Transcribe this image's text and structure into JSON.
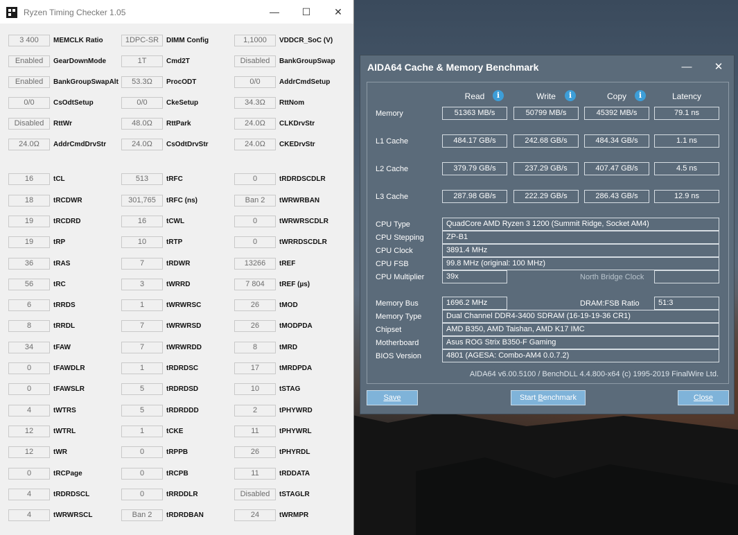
{
  "rtc": {
    "title": "Ryzen Timing Checker 1.05",
    "controls": {
      "minimize": "—",
      "maximize": "☐",
      "close": "✕"
    },
    "rows": [
      [
        {
          "v": "3 400",
          "l": "MEMCLK Ratio"
        },
        {
          "v": "1DPC-SR",
          "l": "DIMM Config"
        },
        {
          "v": "1,1000",
          "l": "VDDCR_SoC (V)"
        }
      ],
      [
        {
          "v": "Enabled",
          "l": "GearDownMode"
        },
        {
          "v": "1T",
          "l": "Cmd2T"
        },
        {
          "v": "Disabled",
          "l": "BankGroupSwap"
        }
      ],
      [
        {
          "v": "Enabled",
          "l": "BankGroupSwapAlt"
        },
        {
          "v": "53.3Ω",
          "l": "ProcODT"
        },
        {
          "v": "0/0",
          "l": "AddrCmdSetup"
        }
      ],
      [
        {
          "v": "0/0",
          "l": "CsOdtSetup"
        },
        {
          "v": "0/0",
          "l": "CkeSetup"
        },
        {
          "v": "34.3Ω",
          "l": "RttNom"
        }
      ],
      [
        {
          "v": "Disabled",
          "l": "RttWr"
        },
        {
          "v": "48.0Ω",
          "l": "RttPark"
        },
        {
          "v": "24.0Ω",
          "l": "CLKDrvStr"
        }
      ],
      [
        {
          "v": "24.0Ω",
          "l": "AddrCmdDrvStr"
        },
        {
          "v": "24.0Ω",
          "l": "CsOdtDrvStr"
        },
        {
          "v": "24.0Ω",
          "l": "CKEDrvStr"
        }
      ],
      [
        {
          "v": "16",
          "l": "tCL"
        },
        {
          "v": "513",
          "l": "tRFC"
        },
        {
          "v": "0",
          "l": "tRDRDSCDLR"
        }
      ],
      [
        {
          "v": "18",
          "l": "tRCDWR"
        },
        {
          "v": "301,765",
          "l": "tRFC (ns)"
        },
        {
          "v": "Ban 2",
          "l": "tWRWRBAN"
        }
      ],
      [
        {
          "v": "19",
          "l": "tRCDRD"
        },
        {
          "v": "16",
          "l": "tCWL"
        },
        {
          "v": "0",
          "l": "tWRWRSCDLR"
        }
      ],
      [
        {
          "v": "19",
          "l": "tRP"
        },
        {
          "v": "10",
          "l": "tRTP"
        },
        {
          "v": "0",
          "l": "tWRRDSCDLR"
        }
      ],
      [
        {
          "v": "36",
          "l": "tRAS"
        },
        {
          "v": "7",
          "l": "tRDWR"
        },
        {
          "v": "13266",
          "l": "tREF"
        }
      ],
      [
        {
          "v": "56",
          "l": "tRC"
        },
        {
          "v": "3",
          "l": "tWRRD"
        },
        {
          "v": "7 804",
          "l": "tREF (µs)"
        }
      ],
      [
        {
          "v": "6",
          "l": "tRRDS"
        },
        {
          "v": "1",
          "l": "tWRWRSC"
        },
        {
          "v": "26",
          "l": "tMOD"
        }
      ],
      [
        {
          "v": "8",
          "l": "tRRDL"
        },
        {
          "v": "7",
          "l": "tWRWRSD"
        },
        {
          "v": "26",
          "l": "tMODPDA"
        }
      ],
      [
        {
          "v": "34",
          "l": "tFAW"
        },
        {
          "v": "7",
          "l": "tWRWRDD"
        },
        {
          "v": "8",
          "l": "tMRD"
        }
      ],
      [
        {
          "v": "0",
          "l": "tFAWDLR"
        },
        {
          "v": "1",
          "l": "tRDRDSC"
        },
        {
          "v": "17",
          "l": "tMRDPDA"
        }
      ],
      [
        {
          "v": "0",
          "l": "tFAWSLR"
        },
        {
          "v": "5",
          "l": "tRDRDSD"
        },
        {
          "v": "10",
          "l": "tSTAG"
        }
      ],
      [
        {
          "v": "4",
          "l": "tWTRS"
        },
        {
          "v": "5",
          "l": "tRDRDDD"
        },
        {
          "v": "2",
          "l": "tPHYWRD"
        }
      ],
      [
        {
          "v": "12",
          "l": "tWTRL"
        },
        {
          "v": "1",
          "l": "tCKE"
        },
        {
          "v": "11",
          "l": "tPHYWRL"
        }
      ],
      [
        {
          "v": "12",
          "l": "tWR"
        },
        {
          "v": "0",
          "l": "tRPPB"
        },
        {
          "v": "26",
          "l": "tPHYRDL"
        }
      ],
      [
        {
          "v": "0",
          "l": "tRCPage"
        },
        {
          "v": "0",
          "l": "tRCPB"
        },
        {
          "v": "11",
          "l": "tRDDATA"
        }
      ],
      [
        {
          "v": "4",
          "l": "tRDRDSCL"
        },
        {
          "v": "0",
          "l": "tRRDDLR"
        },
        {
          "v": "Disabled",
          "l": "tSTAGLR"
        }
      ],
      [
        {
          "v": "4",
          "l": "tWRWRSCL"
        },
        {
          "v": "Ban 2",
          "l": "tRDRDBAN"
        },
        {
          "v": "24",
          "l": "tWRMPR"
        }
      ]
    ]
  },
  "aida": {
    "title": "AIDA64 Cache & Memory Benchmark",
    "controls": {
      "minimize": "—",
      "close": "✕"
    },
    "info_glyph": "i",
    "columns": [
      "Read",
      "Write",
      "Copy",
      "Latency"
    ],
    "bench": [
      {
        "label": "Memory",
        "values": [
          "51363 MB/s",
          "50799 MB/s",
          "45392 MB/s",
          "79.1 ns"
        ]
      },
      {
        "label": "L1 Cache",
        "values": [
          "484.17 GB/s",
          "242.68 GB/s",
          "484.34 GB/s",
          "1.1 ns"
        ]
      },
      {
        "label": "L2 Cache",
        "values": [
          "379.79 GB/s",
          "237.29 GB/s",
          "407.47 GB/s",
          "4.5 ns"
        ]
      },
      {
        "label": "L3 Cache",
        "values": [
          "287.98 GB/s",
          "222.29 GB/s",
          "286.43 GB/s",
          "12.9 ns"
        ]
      }
    ],
    "cpu": {
      "type_label": "CPU Type",
      "type": "QuadCore AMD Ryzen 3 1200  (Summit Ridge, Socket AM4)",
      "stepping_label": "CPU Stepping",
      "stepping": "ZP-B1",
      "clock_label": "CPU Clock",
      "clock": "3891.4 MHz",
      "fsb_label": "CPU FSB",
      "fsb": "99.8 MHz  (original: 100 MHz)",
      "multiplier_label": "CPU Multiplier",
      "multiplier": "39x",
      "nb_clock_label": "North Bridge Clock",
      "nb_clock": ""
    },
    "mem": {
      "bus_label": "Memory Bus",
      "bus": "1696.2 MHz",
      "ratio_label": "DRAM:FSB Ratio",
      "ratio": "51:3",
      "type_label": "Memory Type",
      "type": "Dual Channel DDR4-3400 SDRAM  (16-19-19-36 CR1)",
      "chipset_label": "Chipset",
      "chipset": "AMD B350, AMD Taishan, AMD K17 IMC",
      "motherboard_label": "Motherboard",
      "motherboard": "Asus ROG Strix B350-F Gaming",
      "bios_label": "BIOS Version",
      "bios": "4801  (AGESA: Combo-AM4 0.0.7.2)"
    },
    "footer": "AIDA64 v6.00.5100 / BenchDLL 4.4.800-x64  (c) 1995-2019 FinalWire Ltd.",
    "buttons": {
      "save_u": "S",
      "save_rest": "ave",
      "bench_pre": "Start ",
      "bench_u": "B",
      "bench_rest": "enchmark",
      "close_u": "C",
      "close_rest": "lose"
    }
  }
}
